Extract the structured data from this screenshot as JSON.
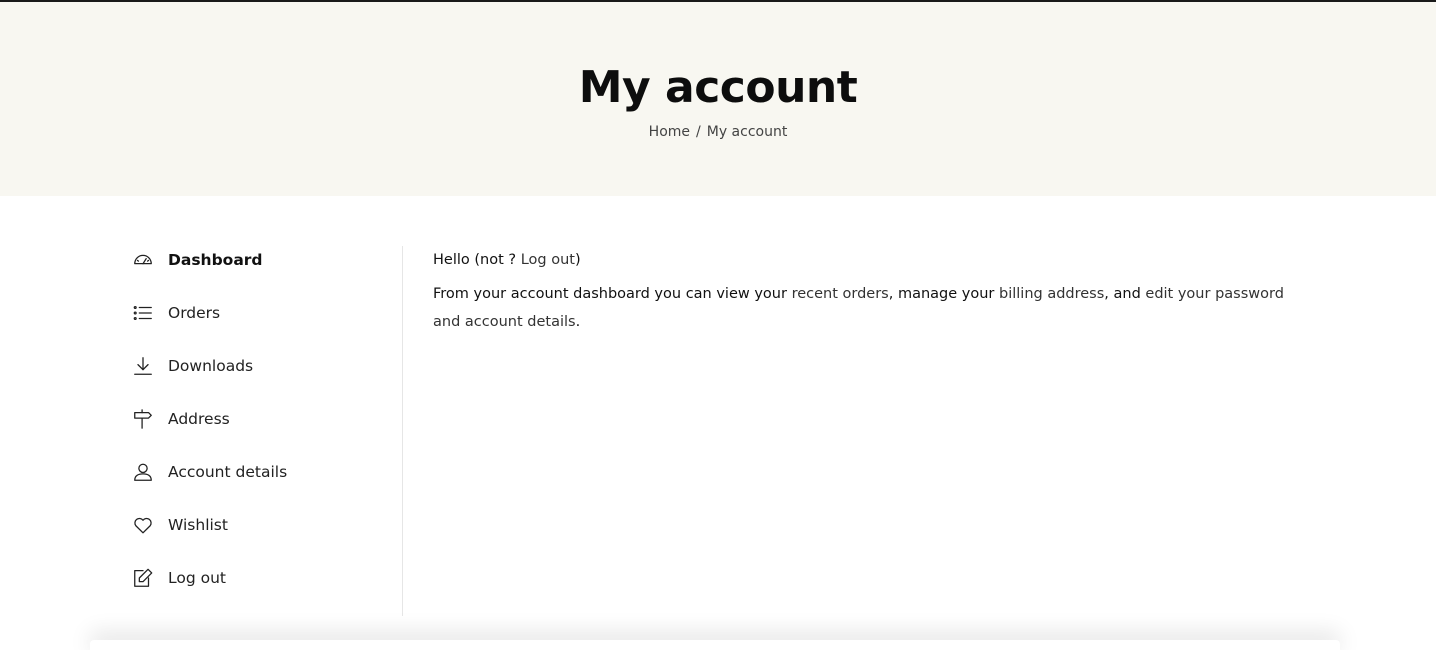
{
  "hero": {
    "title": "My account",
    "breadcrumb": {
      "home": "Home",
      "separator": "/",
      "current": "My account"
    }
  },
  "sidebar": {
    "items": [
      {
        "label": "Dashboard",
        "icon": "dashboard-gauge-icon",
        "active": true
      },
      {
        "label": "Orders",
        "icon": "list-icon"
      },
      {
        "label": "Downloads",
        "icon": "download-icon"
      },
      {
        "label": "Address",
        "icon": "signpost-icon"
      },
      {
        "label": "Account details",
        "icon": "user-icon"
      },
      {
        "label": "Wishlist",
        "icon": "heart-icon"
      },
      {
        "label": "Log out",
        "icon": "edit-icon"
      }
    ]
  },
  "main": {
    "hello_prefix": "Hello (not ? ",
    "logout_link": "Log out",
    "hello_suffix": ")",
    "intro_1": "From your account dashboard you can view your ",
    "recent_orders_link": "recent orders",
    "intro_2": ", manage your ",
    "billing_address_link": "billing address",
    "intro_3": ", and ",
    "edit_account_link": "edit your password and account details",
    "intro_4": "."
  }
}
